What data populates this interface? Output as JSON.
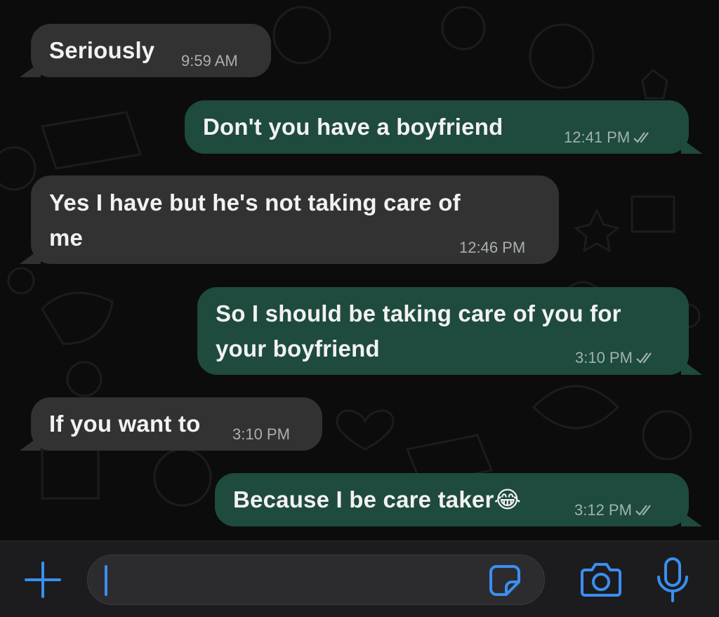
{
  "colors": {
    "incoming_bubble": "#323232",
    "outgoing_bubble": "#1f4a3e",
    "accent": "#3b8ff0",
    "background": "#0c0c0c"
  },
  "messages": [
    {
      "direction": "incoming",
      "text": "Seriously",
      "time": "9:59 AM"
    },
    {
      "direction": "outgoing",
      "text": "Don't you have a boyfriend",
      "time": "12:41 PM",
      "status": "read"
    },
    {
      "direction": "incoming",
      "text_line1": "Yes I have but he's not taking care of",
      "text_line2": "me",
      "time": "12:46 PM"
    },
    {
      "direction": "outgoing",
      "text_line1": "So I should be taking care of you for",
      "text_line2": "your boyfriend",
      "time": "3:10 PM",
      "status": "read"
    },
    {
      "direction": "incoming",
      "text": "If you want to",
      "time": "3:10 PM"
    },
    {
      "direction": "outgoing",
      "text": "Because I be care taker😂",
      "time": "3:12 PM",
      "status": "read"
    }
  ],
  "composer": {
    "add_icon": "plus-icon",
    "sticker_icon": "sticker-icon",
    "camera_icon": "camera-icon",
    "mic_icon": "microphone-icon"
  }
}
